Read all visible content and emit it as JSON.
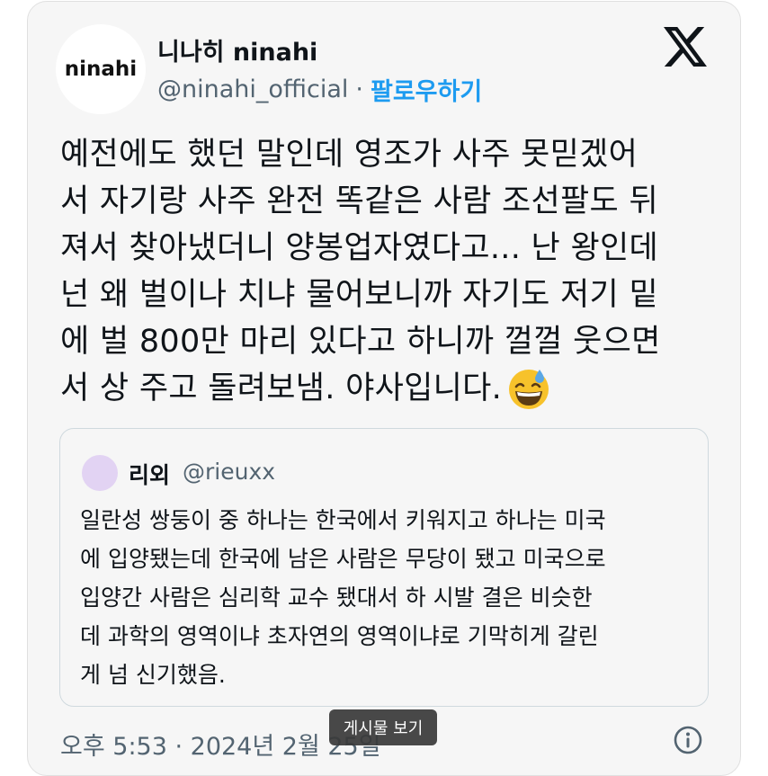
{
  "author": {
    "avatar_text": "ninahi",
    "display_name": "니나히 ninahi",
    "handle": "@ninahi_official",
    "separator": "·",
    "follow_label": "팔로우하기"
  },
  "platform_icon": "x-logo-icon",
  "tweet": {
    "lines": [
      "예전에도 했던 말인데 영조가 사주 못믿겠어",
      "서 자기랑 사주 완전 똑같은 사람 조선팔도 뒤",
      "져서 찾아냈더니 양봉업자였다고... 난 왕인데",
      "넌 왜 벌이나 치냐 물어보니까 자기도 저기 밑",
      "에 벌 800만 마리 있다고 하니까 껄껄 웃으면",
      "서 상 주고 돌려보냄. 야사입니다."
    ],
    "emoji": "grinning-face-with-sweat-emoji"
  },
  "quote": {
    "name": "리외",
    "handle": "@rieuxx",
    "lines": [
      "일란성 쌍둥이 중 하나는 한국에서 키워지고 하나는 미국",
      "에 입양됐는데 한국에 남은 사람은 무당이 됐고 미국으로",
      "입양간 사람은 심리학 교수 됐대서 하 시발 결은 비슷한",
      "데 과학의 영역이냐 초자연의 영역이냐로 기막히게 갈린",
      "게 넘 신기했음."
    ]
  },
  "footer": {
    "timestamp": "오후 5:53 · 2024년 2월 25일",
    "tooltip": "게시물 보기",
    "info_icon": "info-icon"
  },
  "colors": {
    "card_bg": "#f6f6f6",
    "link_blue": "#1d9bf0",
    "secondary_text": "#536471",
    "quote_avatar": "#e2d3f3"
  }
}
